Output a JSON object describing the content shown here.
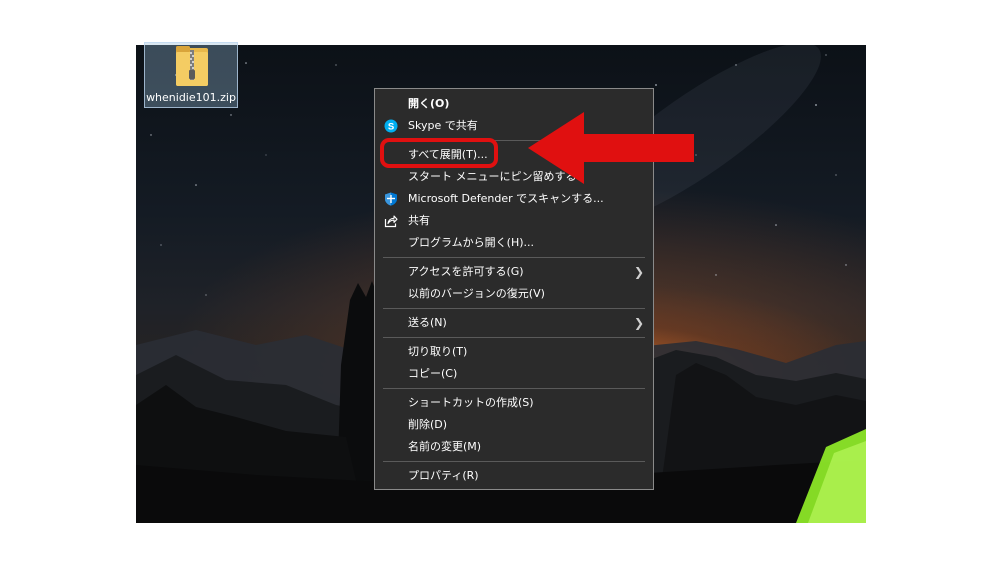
{
  "file": {
    "name": "whenidie101.zip",
    "icon": "zip-folder-icon"
  },
  "menu": {
    "items": [
      {
        "label": "開く(O)",
        "icon": "",
        "submenu": false,
        "bold": true
      },
      {
        "label": "Skype で共有",
        "icon": "skype-icon",
        "submenu": false
      },
      "separator",
      {
        "label": "すべて展開(T)...",
        "icon": "",
        "submenu": false
      },
      {
        "label": "スタート メニューにピン留めする",
        "icon": "",
        "submenu": false
      },
      {
        "label": "Microsoft Defender でスキャンする...",
        "icon": "defender-shield-icon",
        "submenu": false
      },
      {
        "label": "共有",
        "icon": "share-icon",
        "submenu": false
      },
      {
        "label": "プログラムから開く(H)...",
        "icon": "",
        "submenu": false
      },
      "separator",
      {
        "label": "アクセスを許可する(G)",
        "icon": "",
        "submenu": true
      },
      {
        "label": "以前のバージョンの復元(V)",
        "icon": "",
        "submenu": false
      },
      "separator",
      {
        "label": "送る(N)",
        "icon": "",
        "submenu": true
      },
      "separator",
      {
        "label": "切り取り(T)",
        "icon": "",
        "submenu": false
      },
      {
        "label": "コピー(C)",
        "icon": "",
        "submenu": false
      },
      "separator",
      {
        "label": "ショートカットの作成(S)",
        "icon": "",
        "submenu": false
      },
      {
        "label": "削除(D)",
        "icon": "",
        "submenu": false
      },
      {
        "label": "名前の変更(M)",
        "icon": "",
        "submenu": false
      },
      "separator",
      {
        "label": "プロパティ(R)",
        "icon": "",
        "submenu": false
      }
    ]
  },
  "annotation": {
    "highlighted_item": "すべて展開(T)...",
    "color": "#e01010",
    "arrow_icon": "red-arrow-left-icon"
  },
  "colors": {
    "menu_background": "#2b2b2b",
    "menu_border": "#8a8a8a",
    "selection_tint": "#9bb9d7",
    "skype_blue": "#00aff0",
    "defender_blue": "#0078d4",
    "tent_green": "#9bff2a"
  }
}
